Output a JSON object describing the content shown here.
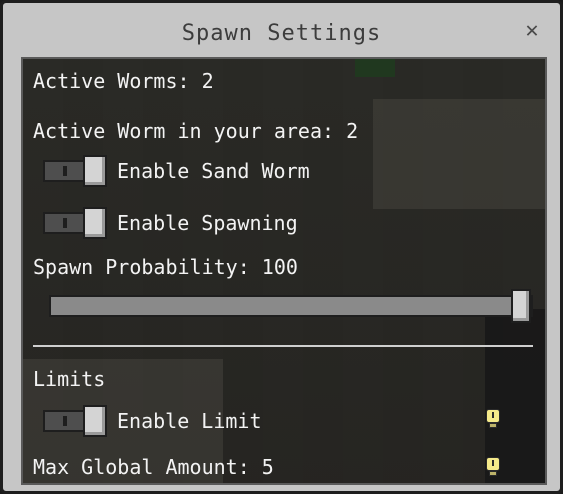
{
  "window": {
    "title": "Spawn Settings",
    "close_glyph": "✕"
  },
  "status": {
    "active_worms": "Active Worms: 2",
    "active_worm_area": "Active Worm in your area: 2"
  },
  "toggles": [
    {
      "label": "Enable Sand Worm",
      "on": true
    },
    {
      "label": "Enable Spawning",
      "on": true
    }
  ],
  "probability": {
    "label": "Spawn Probability: 100",
    "value": 100,
    "min": 0,
    "max": 100
  },
  "limits": {
    "heading": "Limits",
    "enable_limit": {
      "label": "Enable Limit",
      "on": true
    },
    "max_global": "Max Global Amount: 5"
  },
  "icons": {
    "info": "info-lightbulb-icon",
    "close": "close-icon"
  },
  "colors": {
    "panel_bg": "#2a2925",
    "frame": "#c6c6c6",
    "text": "#f3f3f3",
    "info_icon": "#f5ea8a"
  }
}
